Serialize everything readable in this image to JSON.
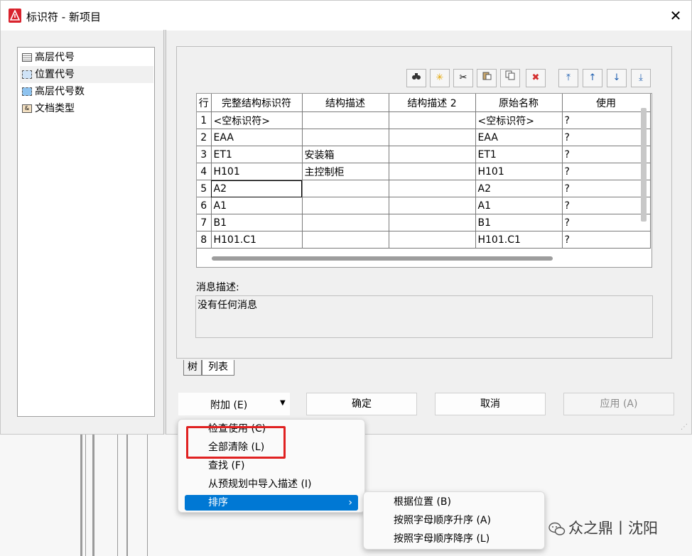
{
  "window": {
    "title": "标识符 - 新项目",
    "close_symbol": "✕"
  },
  "tree": {
    "items": [
      {
        "label": "高层代号",
        "selected": false
      },
      {
        "label": "位置代号",
        "selected": true
      },
      {
        "label": "高层代号数",
        "selected": false
      },
      {
        "label": "文档类型",
        "selected": false
      }
    ]
  },
  "toolbar": {
    "icons": [
      "find-icon",
      "new-icon",
      "cut-icon",
      "paste-icon",
      "copy-icon",
      "delete-icon",
      "move-top-icon",
      "move-up-icon",
      "move-down-icon",
      "move-bottom-icon"
    ]
  },
  "table": {
    "columns": [
      "行",
      "完整结构标识符",
      "结构描述",
      "结构描述 2",
      "原始名称",
      "使用"
    ],
    "rows": [
      [
        "1",
        "<空标识符>",
        "",
        "",
        "<空标识符>",
        "?"
      ],
      [
        "2",
        "EAA",
        "",
        "",
        "EAA",
        "?"
      ],
      [
        "3",
        "ET1",
        "安装箱",
        "",
        "ET1",
        "?"
      ],
      [
        "4",
        "H101",
        "主控制柜",
        "",
        "H101",
        "?"
      ],
      [
        "5",
        "A2",
        "",
        "",
        "A2",
        "?"
      ],
      [
        "6",
        "A1",
        "",
        "",
        "A1",
        "?"
      ],
      [
        "7",
        "B1",
        "",
        "",
        "B1",
        "?"
      ],
      [
        "8",
        "H101.C1",
        "",
        "",
        "H101.C1",
        "?"
      ]
    ]
  },
  "message": {
    "label": "消息描述:",
    "text": "没有任何消息"
  },
  "tabs": [
    "树",
    "列表"
  ],
  "buttons": {
    "attach": "附加 (E)",
    "ok": "确定",
    "cancel": "取消",
    "apply": "应用 (A)"
  },
  "menu": {
    "items": [
      "检查使用 (C)",
      "全部清除 (L)",
      "查找 (F)",
      "从预规划中导入描述 (I)",
      "排序"
    ],
    "submenu_arrow": "›",
    "highlighted": "排序"
  },
  "submenu": {
    "items": [
      "根据位置 (B)",
      "按照字母顺序升序 (A)",
      "按照字母顺序降序 (L)"
    ]
  },
  "watermark": {
    "text": "众之鼎丨沈阳"
  },
  "colors": {
    "accent": "#0078d4",
    "highlight_box": "#e02121",
    "app_icon": "#d9232d"
  }
}
